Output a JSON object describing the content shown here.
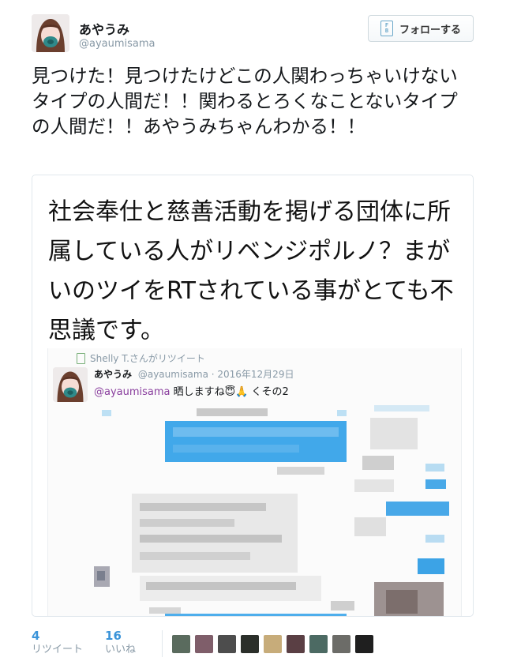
{
  "tweet": {
    "display_name": "あやうみ",
    "screen_name": "@ayaumisama",
    "text": "見つけた！見つけたけどこの人関わっちゃいけないタイプの人間だ！！関わるとろくなことないタイプの人間だ！！あやうみちゃんわかる！！"
  },
  "follow_button": {
    "label": "フォローする",
    "icon": "follow-icon",
    "icon_text": "F\nB"
  },
  "card": {
    "text": "社会奉仕と慈善活動を掲げる団体に所属している人がリベンジポルノ？まがいのツイをRTされている事がとても不思議です。",
    "embedded": {
      "retweet_label": "Shelly T.さんがリツイート",
      "display_name": "あやうみ",
      "handle_date": "@ayaumisama · 2016年12月29日",
      "mention": "@ayaumisama",
      "text_rest": " 晒しますね😇🙏 くその2"
    }
  },
  "stats": {
    "retweets": {
      "count": "4",
      "label": "リツイート"
    },
    "likes": {
      "count": "16",
      "label": "いいね"
    }
  },
  "likers": [
    {
      "name": "liker-1",
      "color": "#5a6b5e"
    },
    {
      "name": "liker-2",
      "color": "#7f5e6a"
    },
    {
      "name": "liker-3",
      "color": "#4d4d4d"
    },
    {
      "name": "liker-4",
      "color": "#2b2f2a"
    },
    {
      "name": "liker-5",
      "color": "#c7ac7a"
    },
    {
      "name": "liker-6",
      "color": "#5a3f44"
    },
    {
      "name": "liker-7",
      "color": "#4c6a63"
    },
    {
      "name": "liker-8",
      "color": "#6c6c68"
    },
    {
      "name": "liker-9",
      "color": "#1f1f1f"
    }
  ],
  "colors": {
    "link_blue": "#3b94d9",
    "muted": "#8899a6",
    "mention_purple": "#8a3f9e",
    "blur_blue": "#3ca3e6"
  }
}
